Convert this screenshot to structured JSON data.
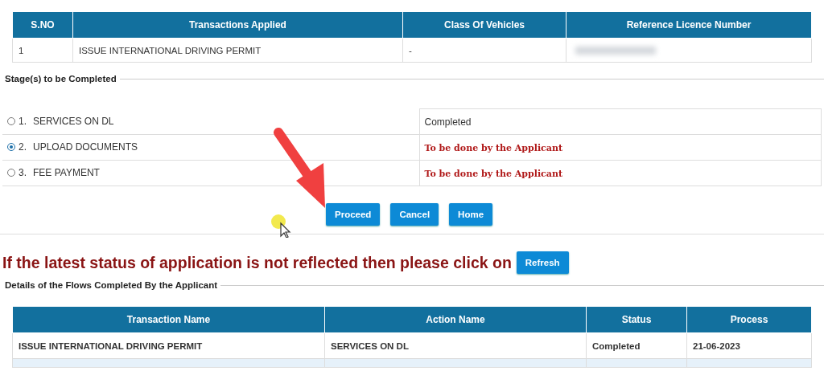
{
  "applied_table": {
    "columns": [
      "S.NO",
      "Transactions Applied",
      "Class Of Vehicles",
      "Reference Licence Number"
    ],
    "rows": [
      {
        "sno": "1",
        "transaction": "ISSUE INTERNATIONAL DRIVING PERMIT",
        "class": "-",
        "reference_redacted": true
      }
    ]
  },
  "stages_legend": "Stage(s) to be Completed",
  "stages": [
    {
      "number": "1.",
      "name": "SERVICES ON DL",
      "selected": false,
      "status": "Completed",
      "kind": "done"
    },
    {
      "number": "2.",
      "name": "UPLOAD DOCUMENTS",
      "selected": true,
      "status": "To be done by the Applicant",
      "kind": "pending"
    },
    {
      "number": "3.",
      "name": "FEE PAYMENT",
      "selected": false,
      "status": "To be done by the Applicant",
      "kind": "pending"
    }
  ],
  "buttons": [
    "Proceed",
    "Cancel",
    "Home"
  ],
  "notice": "If the latest status of application is not reflected then please click on",
  "refresh_button": "Refresh",
  "flows_legend": "Details of the Flows Completed By the Applicant",
  "flows_table": {
    "columns": [
      "Transaction Name",
      "Action Name",
      "Status",
      "Process"
    ],
    "rows": [
      [
        "ISSUE INTERNATIONAL DRIVING PERMIT",
        "SERVICES ON DL",
        "Completed",
        "21-06-2023"
      ]
    ]
  }
}
